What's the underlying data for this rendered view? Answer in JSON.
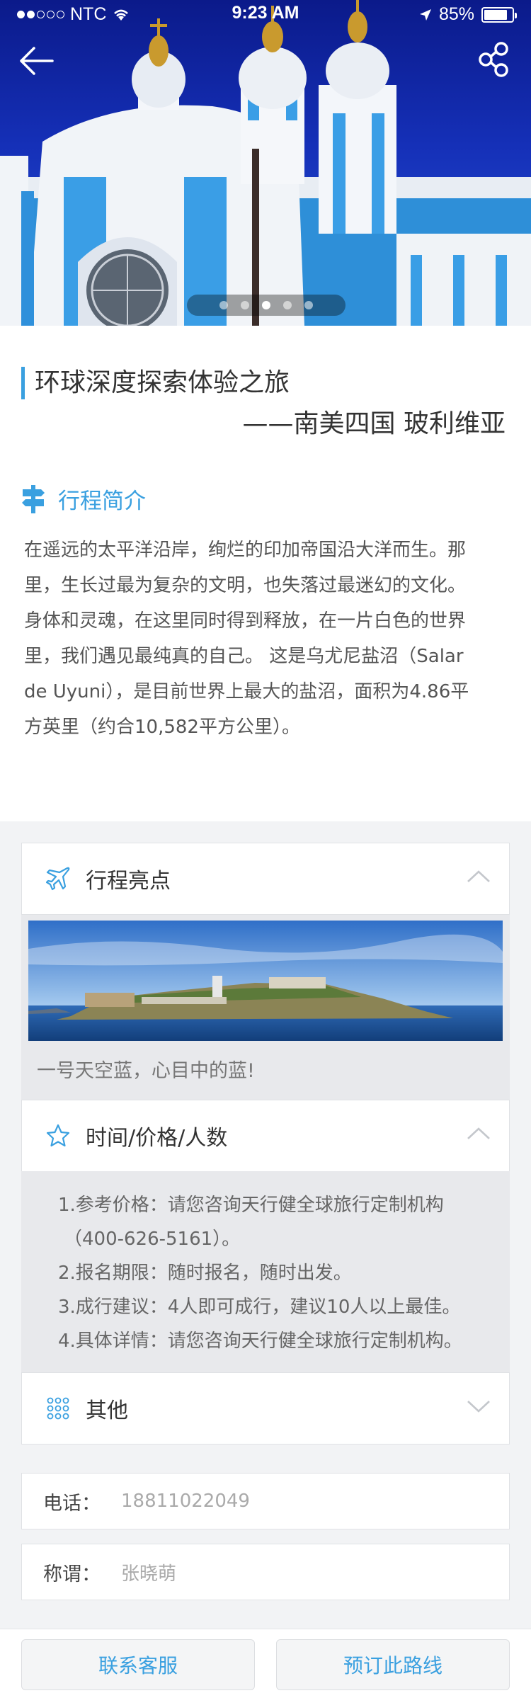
{
  "status_bar": {
    "carrier": "NTC",
    "time": "9:23 AM",
    "battery": "85%",
    "battery_level": 0.85
  },
  "hero": {
    "slide_count": 5,
    "active_slide": 3
  },
  "trip": {
    "title": "环球深度探索体验之旅",
    "subtitle": "——南美四国 玻利维亚"
  },
  "overview": {
    "heading": "行程简介",
    "lines": [
      "在遥远的太平洋沿岸，绚烂的印加帝国沿大洋而生。那",
      "里，生长过最为复杂的文明，也失落过最迷幻的文化。",
      "身体和灵魂，在这里同时得到释放，在一片白色的世界",
      "里，我们遇见最纯真的自己。 这是乌尤尼盐沼（Salar",
      "de Uyuni），是目前世界上最大的盐沼，面积为4.86平",
      "方英里（约合10,582平方公里）。"
    ]
  },
  "highlights": {
    "heading": "行程亮点",
    "caption": "一号天空蓝，心目中的蓝!"
  },
  "time_price": {
    "heading": "时间/价格/人数",
    "lines": [
      "1.参考价格：请您咨询天行健全球旅行定制机构",
      "（400-626-5161）。",
      "2.报名期限：随时报名，随时出发。",
      "3.成行建议：4人即可成行，建议10人以上最佳。",
      "4.具体详情：请您咨询天行健全球旅行定制机构。"
    ]
  },
  "other": {
    "heading": "其他"
  },
  "form": {
    "phone_label": "电话：",
    "phone_value": "18811022049",
    "name_label": "称谓：",
    "name_value": "张晓萌"
  },
  "actions": {
    "contact": "联系客服",
    "book": "预订此路线"
  },
  "colors": {
    "accent": "#3aa0e0"
  }
}
